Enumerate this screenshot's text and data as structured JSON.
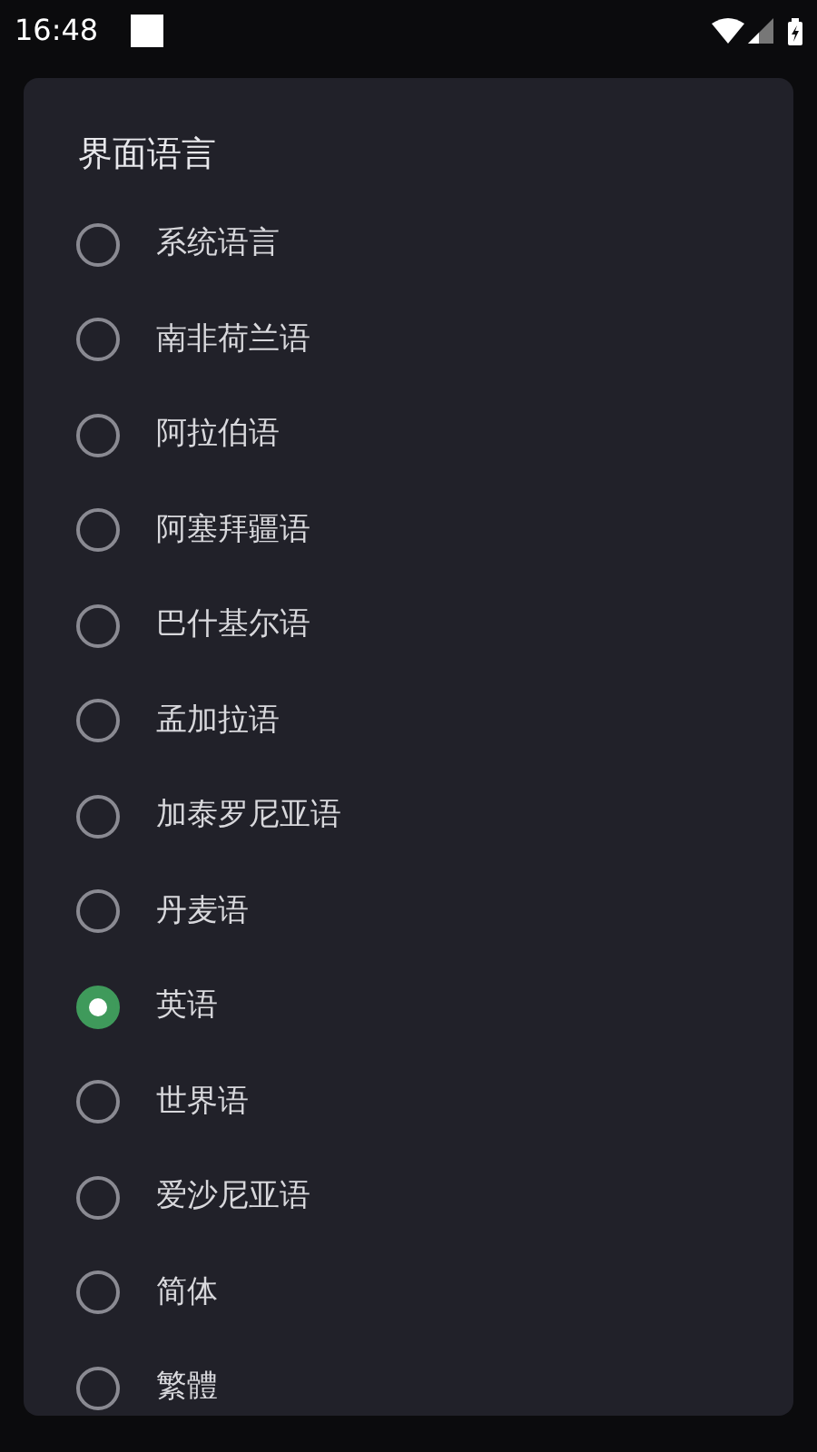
{
  "status_bar": {
    "time": "16:48"
  },
  "dialog": {
    "title": "界面语言",
    "options": [
      {
        "label": "系统语言",
        "selected": false
      },
      {
        "label": "南非荷兰语",
        "selected": false
      },
      {
        "label": "阿拉伯语",
        "selected": false
      },
      {
        "label": "阿塞拜疆语",
        "selected": false
      },
      {
        "label": "巴什基尔语",
        "selected": false
      },
      {
        "label": "孟加拉语",
        "selected": false
      },
      {
        "label": "加泰罗尼亚语",
        "selected": false
      },
      {
        "label": "丹麦语",
        "selected": false
      },
      {
        "label": "英语",
        "selected": true
      },
      {
        "label": "世界语",
        "selected": false
      },
      {
        "label": "爱沙尼亚语",
        "selected": false
      },
      {
        "label": "简体",
        "selected": false
      },
      {
        "label": "繁體",
        "selected": false
      }
    ]
  }
}
